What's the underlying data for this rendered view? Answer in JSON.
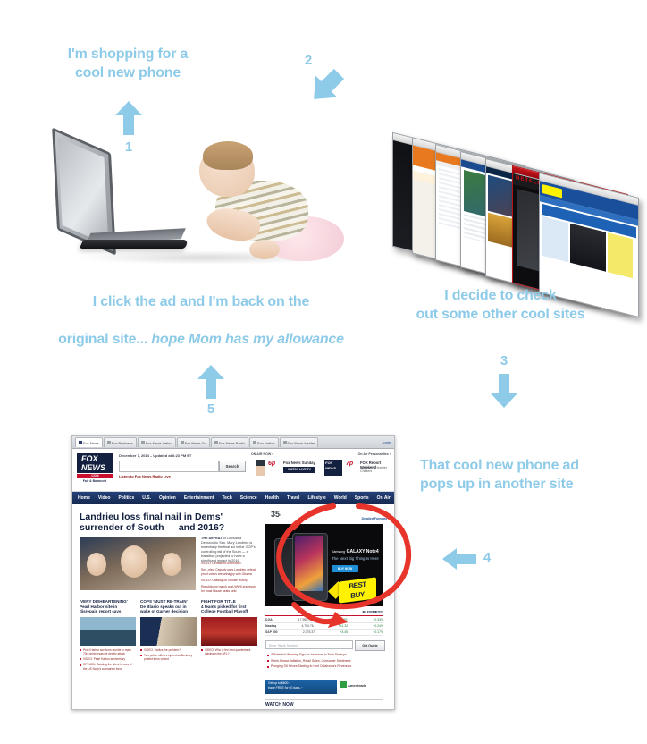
{
  "infographic": {
    "steps": [
      {
        "number": "1",
        "direction": "up"
      },
      {
        "number": "2",
        "direction": "down-right"
      },
      {
        "number": "3",
        "direction": "down"
      },
      {
        "number": "4",
        "direction": "left"
      },
      {
        "number": "5",
        "direction": "up"
      }
    ],
    "captions": {
      "step1": "I'm shopping for a\ncool new phone",
      "step3_line1": "I decide to check",
      "step3_line2": "out some other cool sites",
      "step4_line1": "That cool new phone ad",
      "step4_line2": "pops up in another site",
      "step5_part1": "I click the ad and I'm back on the",
      "step5_part2": "original site... ",
      "step5_italic": "hope Mom has my allowance"
    },
    "colors": {
      "accent_blue": "#8ecbe8",
      "annotation_red": "#e8352c",
      "fox_navy": "#13203f",
      "fox_red": "#c8102e"
    }
  },
  "browser_stack": {
    "label": "browser-window-stack",
    "sites": [
      "Generic Dark Site",
      "eBay",
      "Wiki Article",
      "News Portal",
      "Sports Site",
      "Netflix",
      "Best Buy"
    ]
  },
  "fox_page": {
    "tabs": [
      {
        "label": "Fox News",
        "active": true
      },
      {
        "label": "Fox Business",
        "active": false
      },
      {
        "label": "Fox News Latino",
        "active": false
      },
      {
        "label": "Fox News Go",
        "active": false
      },
      {
        "label": "Fox News Radio",
        "active": false
      },
      {
        "label": "Fox Nation",
        "active": false
      },
      {
        "label": "Fox News Insider",
        "active": false
      }
    ],
    "login_label": "Login",
    "logo": {
      "line1": "FOX",
      "line2": "NEWS",
      "dotcom": ".COM",
      "tagline": "Fair & Balanced"
    },
    "date_line": "December 7, 2014 – Updated at 6:23 PM ET",
    "search_placeholder": "",
    "search_button": "Search",
    "radio_link": "Listen to Fox News Radio Live ›",
    "on_air_now_label": "ON AIR NOW ›",
    "on_air_personalities_label": "On Air Personalities ›",
    "on_air": {
      "time": "6p",
      "suffix": "ET",
      "show": "Fox News Sunday",
      "button": "WATCH LIVE TV"
    },
    "next_show": {
      "time": "7p",
      "suffix": "ET",
      "show": "FOX Report Weekend",
      "host": "Hosted by Heather Childers"
    },
    "nav": [
      "Home",
      "Video",
      "Politics",
      "U.S.",
      "Opinion",
      "Entertainment",
      "Tech",
      "Science",
      "Health",
      "Travel",
      "Lifestyle",
      "World",
      "Sports",
      "On Air"
    ],
    "headline": "Landrieu loss final nail in Dems' surrender of South — and 2016?",
    "lede_bold": "THE DEFEAT",
    "lede_rest": " of Louisiana Democratic Sen. Mary Landrieu is essentially the final act in the GOP's controlling fall of the South — a transition projected to have a significant impact in 2016.",
    "lede_links": [
      "VIDEO: Demise of Dixiecrats?",
      "Sen.-elect Cassidy says Landrieu defeat proof voters are unhappy with Obama",
      "VIDEO: Cassidy on Senate victory",
      "Republicans match post-WWII-era record for most House seats held"
    ],
    "weather": {
      "temp": "35",
      "unit": "º",
      "forecast_link": "Detailed Forecast ›"
    },
    "ad": {
      "brand": "Samsung",
      "product": "GALAXY Note4",
      "tagline": "The Next Big Thing Is Here",
      "cta": "BUY NOW",
      "retailer_line1": "BEST",
      "retailer_line2": "BUY"
    },
    "business": {
      "section_title": "BUSINESS",
      "ticker": [
        {
          "name": "DJIA",
          "value": "17,958.79",
          "change": "+58.69",
          "pct": "+0.33%"
        },
        {
          "name": "Nasdaq",
          "value": "4,780.76",
          "change": "+11.32",
          "pct": "+0.24%"
        },
        {
          "name": "S&P 500",
          "value": "2,075.37",
          "change": "+3.45",
          "pct": "+0.17%"
        }
      ],
      "stock_placeholder": "Enter Stock Symbol",
      "quote_button": "Get Quote",
      "links": [
        "A Potential Warning Sign for Investors in Tech Startups",
        "Week Ahead: Inflation, Retail Sales, Consumer Sentiment",
        "Plunging Oil Prices Starting to Hurt Oklahoma's Revenues"
      ],
      "promo_line1": "Get up to $600 ›",
      "promo_line2": "trade FREE for 60 days. ›",
      "promo_brand": "Ameritrade",
      "watch_now": "WATCH NOW"
    },
    "cards": [
      {
        "kicker": "'VERY DISHEARTENING'",
        "headline": "Pearl Harbor site in disrepair, report says",
        "links": [
          "Pearl Harbor survivors reunite to mark 73rd anniversary of deadly attack",
          "VIDEO: Pearl Harbor anniversary",
          "OPINION: Saluting the silent heroes of the US Navy's submarine force"
        ]
      },
      {
        "kicker": "COPS 'MUST RE-TRAIN'",
        "headline": "De Blasio speaks out in wake of Garner decision",
        "links": [
          "VIDEO: Tactics the problem?",
          "Two police officers injured as Berkeley protest turns violent"
        ]
      },
      {
        "kicker": "FIGHT FOR TITLE",
        "headline": "4 teams picked for first College Football Playoff",
        "links": [
          "VIDEO: Who is the best quarterback playing in the NFL?"
        ]
      }
    ]
  }
}
